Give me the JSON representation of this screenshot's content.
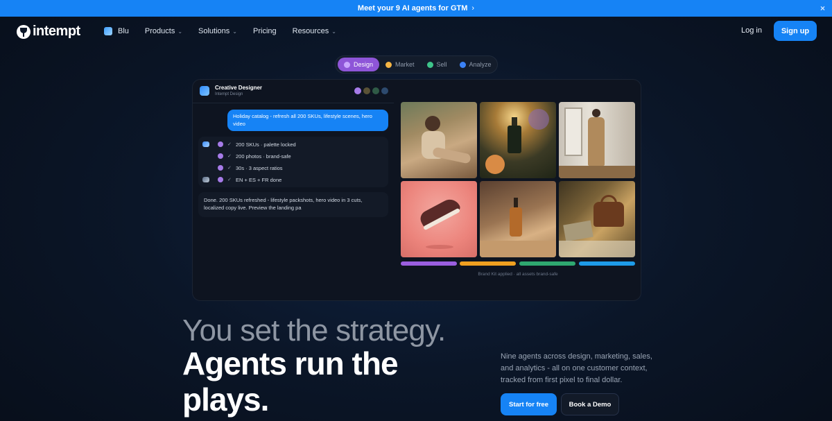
{
  "banner": {
    "text": "Meet your 9 AI agents for GTM",
    "arrow": "›",
    "close": "×"
  },
  "nav": {
    "logo": "intempt",
    "items": [
      {
        "label": "Blu",
        "has_dropdown": false
      },
      {
        "label": "Products",
        "has_dropdown": true
      },
      {
        "label": "Solutions",
        "has_dropdown": true
      },
      {
        "label": "Pricing",
        "has_dropdown": false
      },
      {
        "label": "Resources",
        "has_dropdown": true
      }
    ],
    "chevron": "⌄",
    "login": "Log in",
    "signup": "Sign up"
  },
  "tabs": [
    {
      "label": "Design",
      "active": true,
      "color": "#b48af0"
    },
    {
      "label": "Market",
      "active": false,
      "color": "#f5b544"
    },
    {
      "label": "Sell",
      "active": false,
      "color": "#3ec48a"
    },
    {
      "label": "Analyze",
      "active": false,
      "color": "#3b82f6"
    }
  ],
  "chat": {
    "title": "Creative Designer",
    "subtitle": "Intempt Design",
    "header_dots": [
      "#a67be8",
      "#5a5236",
      "#2f5a46",
      "#2d4a6e"
    ],
    "user_message": "Holiday catalog - refresh all 200 SKUs, lifestyle scenes, hero video",
    "check": "✓",
    "tasks": [
      "200 SKUs · palette locked",
      "200 photos · brand-safe",
      "30s · 3 aspect ratios",
      "EN + ES + FR done"
    ],
    "reply": "Done. 200 SKUs refreshed - lifestyle packshots, hero video in 3 cuts, localized copy live. Preview the landing pa"
  },
  "gallery": {
    "images": [
      "woman-on-terrace-image",
      "perfume-bottle-in-flowers-image",
      "woman-in-trench-coat-image",
      "sneaker-on-pink-image",
      "serum-bottle-image",
      "leather-bag-still-life-image"
    ],
    "bar_colors": [
      "#9b5fe0",
      "#f0a020",
      "#2fa870",
      "#1e9be8"
    ],
    "caption": "Brand Kit applied · all assets brand-safe"
  },
  "hero": {
    "headline_light": "You set the strategy.",
    "headline_bold_1": "Agents run the",
    "headline_bold_2": "plays.",
    "description": "Nine agents across design, marketing, sales, and analytics - all on one customer context, tracked from first pixel to final dollar.",
    "cta_primary": "Start for free",
    "cta_secondary": "Book a Demo"
  }
}
